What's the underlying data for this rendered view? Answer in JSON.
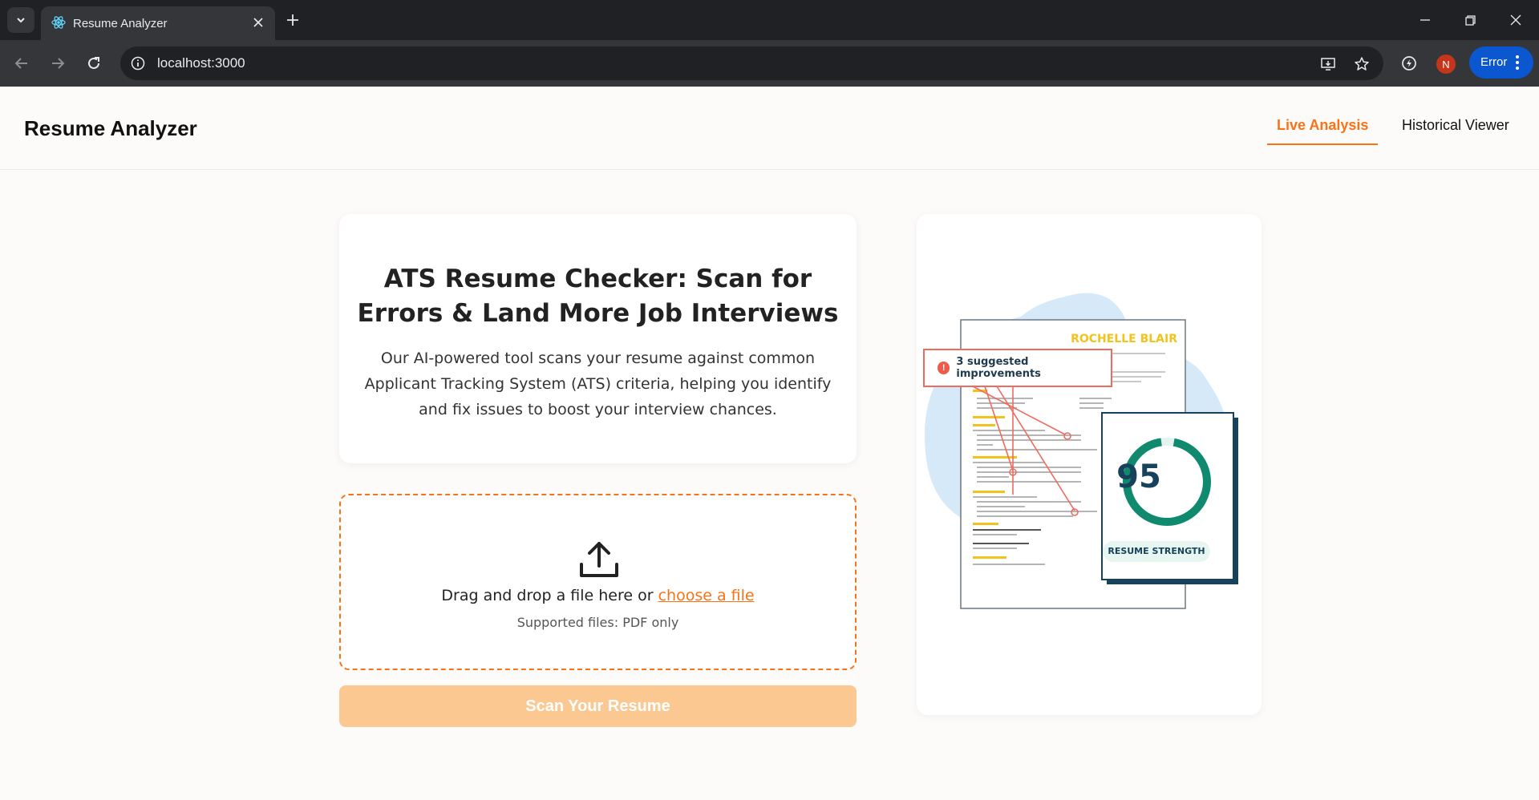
{
  "browser": {
    "tab_title": "Resume Analyzer",
    "url": "localhost:3000",
    "profile_initial": "N",
    "error_label": "Error"
  },
  "header": {
    "brand": "Resume Analyzer",
    "tabs": [
      {
        "label": "Live Analysis",
        "active": true
      },
      {
        "label": "Historical Viewer",
        "active": false
      }
    ]
  },
  "hero": {
    "title": "ATS Resume Checker: Scan for Errors & Land More Job Interviews",
    "description": "Our AI-powered tool scans your resume against common Applicant Tracking System (ATS) criteria, helping you identify and fix issues to boost your interview chances."
  },
  "upload": {
    "prompt": "Drag and drop a file here or",
    "link_text": "choose a file",
    "supported": "Supported files: PDF only"
  },
  "scan_button": "Scan Your Resume",
  "illustration": {
    "candidate_name": "ROCHELLE BLAIR",
    "callout": "3 suggested improvements",
    "callout_icon": "!",
    "score": "95",
    "score_label": "RESUME STRENGTH",
    "colors": {
      "accent": "#f97316",
      "score_ring": "#0f8a6e",
      "blob": "#d6e9f8",
      "callout": "#ef6b5e"
    }
  }
}
